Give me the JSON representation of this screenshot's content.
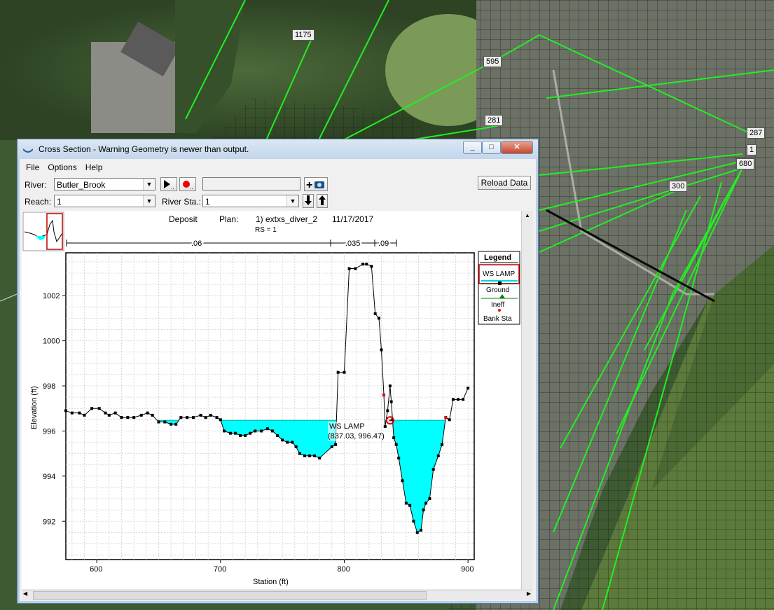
{
  "map": {
    "labels": [
      "1175",
      "595",
      "281",
      "287",
      "1",
      "680",
      "300"
    ]
  },
  "window": {
    "title": "Cross Section - Warning Geometry is newer than output.",
    "minimize": "_",
    "maximize": "□",
    "close": "✕"
  },
  "menu": {
    "file": "File",
    "options": "Options",
    "help": "Help"
  },
  "toolbar": {
    "river_label": "River:",
    "river_value": "Butler_Brook",
    "reach_label": "Reach:",
    "reach_value": "1",
    "river_sta_label": "River Sta.:",
    "river_sta_value": "1",
    "reload": "Reload Data",
    "play_icon": "play-icon",
    "record_icon": "record-icon",
    "camera_icon": "camera-icon"
  },
  "plot_header": {
    "name": "Deposit",
    "plan_label": "Plan:",
    "plan_value": "1) extxs_diver_2",
    "date": "11/17/2017",
    "rs": "RS = 1"
  },
  "mannings": [
    ".06",
    ".035",
    ".09"
  ],
  "legend": {
    "title": "Legend",
    "items": [
      "WS LAMP",
      "Ground",
      "Ineff",
      "Bank Sta"
    ]
  },
  "tooltip": {
    "name": "WS LAMP",
    "coords": "(837.03, 996.47)"
  },
  "colors": {
    "water": "#00ffff",
    "ground": "#000000",
    "ineff": "#008000",
    "bank": "#ff0000"
  },
  "chart_data": {
    "type": "line",
    "xlabel": "Station (ft)",
    "ylabel": "Elevation (ft)",
    "xlim": [
      575,
      905
    ],
    "ylim": [
      990.3,
      1003.9
    ],
    "xticks": [
      600,
      700,
      800,
      900
    ],
    "yticks": [
      992,
      994,
      996,
      998,
      1000,
      1002
    ],
    "ws_elevation": 996.47,
    "series": [
      {
        "name": "Ground",
        "points": [
          [
            575,
            996.9
          ],
          [
            580,
            996.8
          ],
          [
            586,
            996.8
          ],
          [
            590,
            996.7
          ],
          [
            596,
            997.0
          ],
          [
            602,
            997.0
          ],
          [
            607,
            996.8
          ],
          [
            610,
            996.7
          ],
          [
            615,
            996.8
          ],
          [
            620,
            996.6
          ],
          [
            625,
            996.6
          ],
          [
            630,
            996.6
          ],
          [
            636,
            996.7
          ],
          [
            641,
            996.8
          ],
          [
            645,
            996.7
          ],
          [
            650,
            996.4
          ],
          [
            655,
            996.4
          ],
          [
            660,
            996.3
          ],
          [
            664,
            996.3
          ],
          [
            668,
            996.6
          ],
          [
            673,
            996.6
          ],
          [
            678,
            996.6
          ],
          [
            684,
            996.7
          ],
          [
            688,
            996.6
          ],
          [
            692,
            996.7
          ],
          [
            697,
            996.6
          ],
          [
            700,
            996.5
          ],
          [
            703,
            996.0
          ],
          [
            708,
            995.9
          ],
          [
            712,
            995.9
          ],
          [
            716,
            995.8
          ],
          [
            720,
            995.8
          ],
          [
            724,
            995.9
          ],
          [
            728,
            996.0
          ],
          [
            733,
            996.0
          ],
          [
            738,
            996.1
          ],
          [
            742,
            996.0
          ],
          [
            746,
            995.8
          ],
          [
            750,
            995.6
          ],
          [
            754,
            995.5
          ],
          [
            758,
            995.5
          ],
          [
            761,
            995.3
          ],
          [
            764,
            995.0
          ],
          [
            768,
            994.9
          ],
          [
            772,
            994.9
          ],
          [
            776,
            994.9
          ],
          [
            780,
            994.8
          ],
          [
            790,
            995.3
          ],
          [
            793,
            995.4
          ],
          [
            795,
            998.6
          ],
          [
            800,
            998.6
          ],
          [
            804,
            1003.2
          ],
          [
            809,
            1003.2
          ],
          [
            815,
            1003.4
          ],
          [
            818,
            1003.4
          ],
          [
            822,
            1003.3
          ],
          [
            825,
            1001.2
          ],
          [
            828,
            1001.0
          ],
          [
            830,
            999.6
          ],
          [
            832,
            997.6
          ],
          [
            833,
            996.2
          ],
          [
            835,
            996.9
          ],
          [
            837,
            998.0
          ],
          [
            838,
            997.3
          ],
          [
            839,
            996.5
          ],
          [
            840,
            995.7
          ],
          [
            842,
            995.4
          ],
          [
            844,
            994.8
          ],
          [
            847,
            993.8
          ],
          [
            850,
            992.8
          ],
          [
            853,
            992.7
          ],
          [
            856,
            992.0
          ],
          [
            859,
            991.5
          ],
          [
            862,
            991.6
          ],
          [
            864,
            992.5
          ],
          [
            866,
            992.8
          ],
          [
            869,
            993.0
          ],
          [
            872,
            994.3
          ],
          [
            876,
            994.9
          ],
          [
            879,
            995.4
          ],
          [
            882,
            996.6
          ],
          [
            885,
            996.5
          ],
          [
            888,
            997.4
          ],
          [
            892,
            997.4
          ],
          [
            896,
            997.4
          ],
          [
            900,
            997.9
          ]
        ]
      }
    ],
    "bank_stations": [
      832,
      882
    ]
  }
}
